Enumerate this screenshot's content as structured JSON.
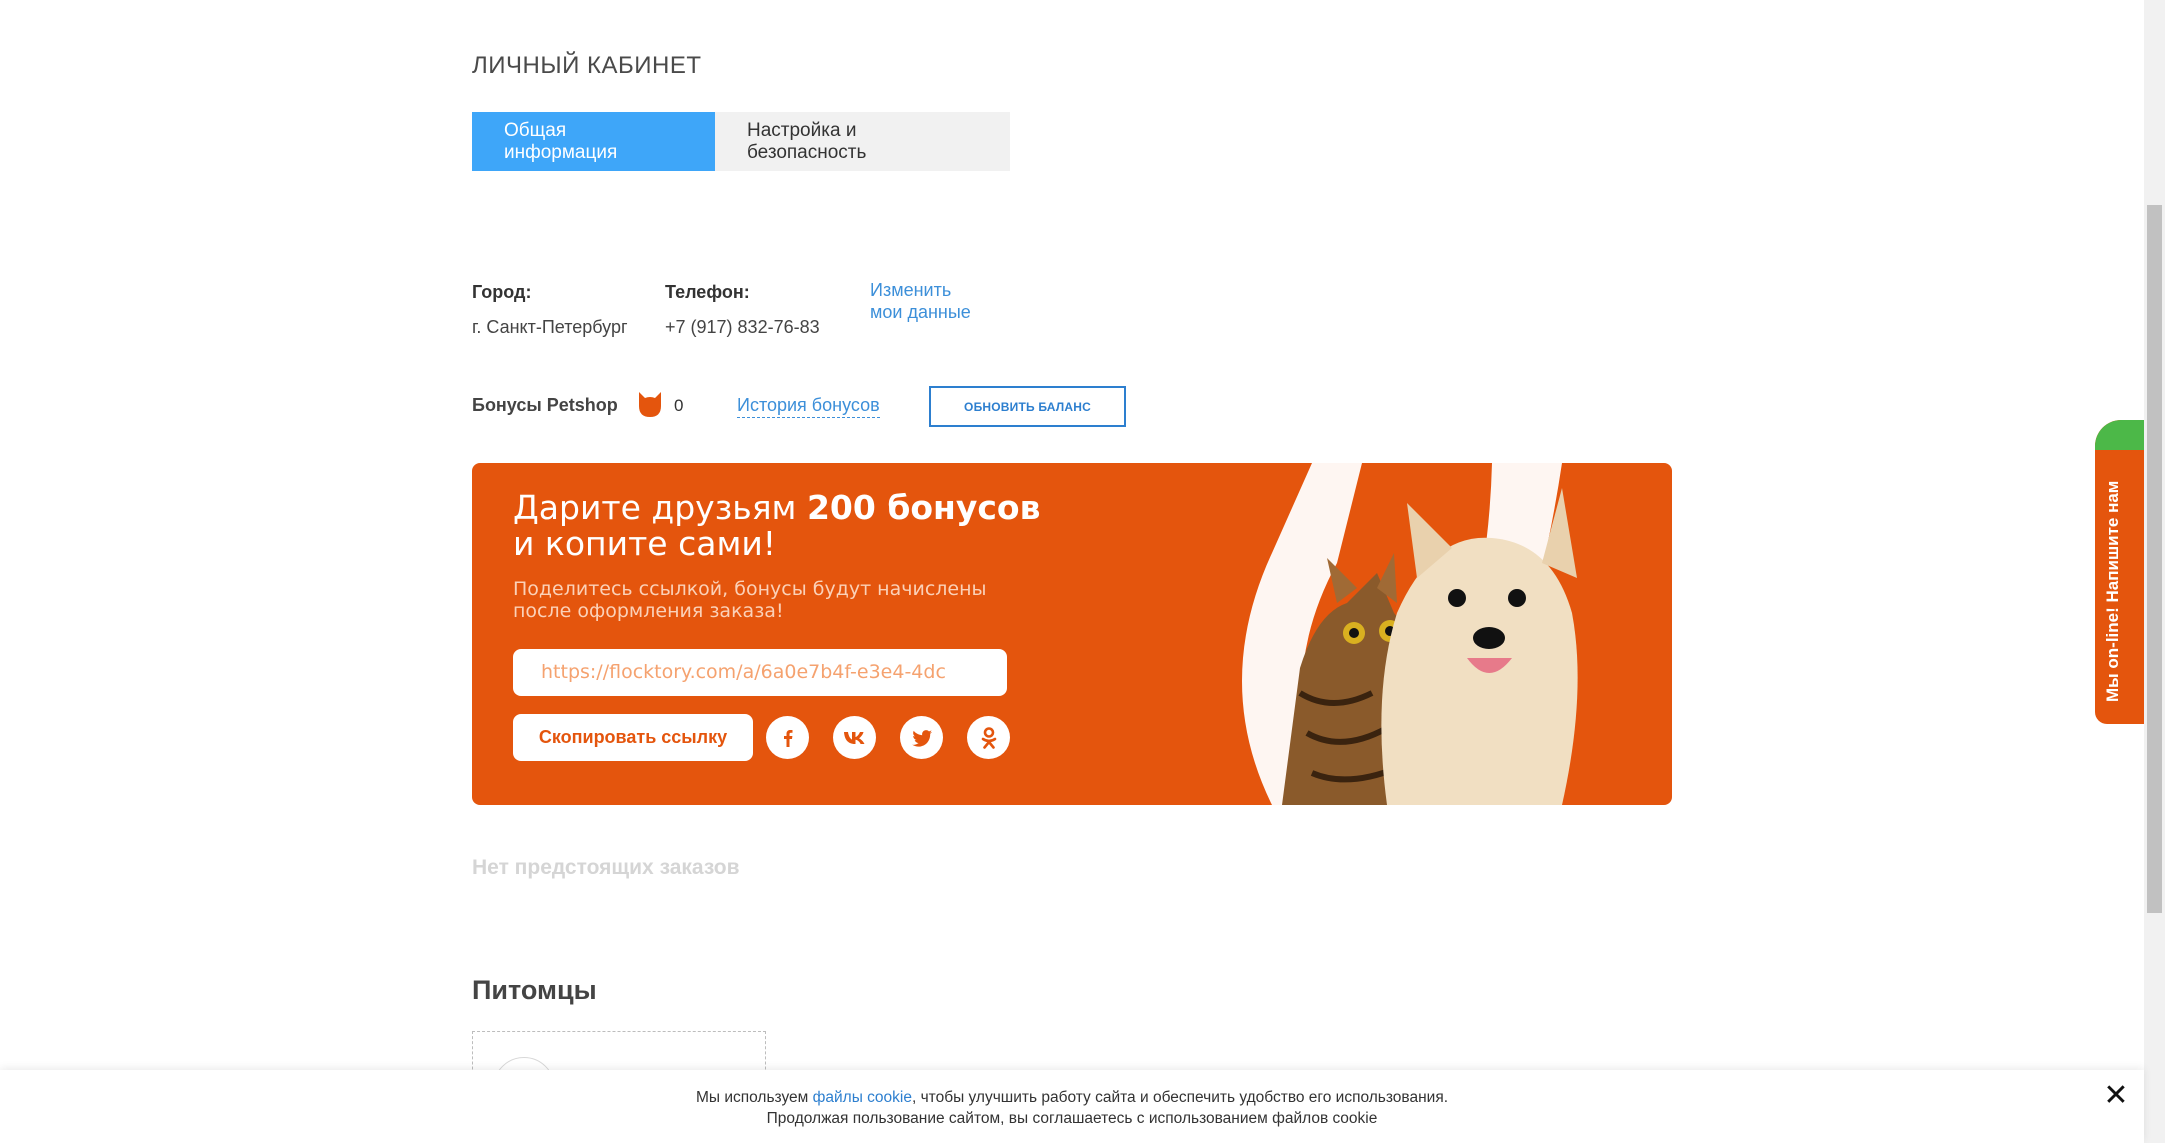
{
  "page": {
    "title": "ЛИЧНЫЙ КАБИНЕТ"
  },
  "tabs": [
    {
      "label": "Общая информация",
      "active": true
    },
    {
      "label": "Настройка и безопасность",
      "active": false
    }
  ],
  "profile": {
    "city_label": "Город:",
    "city_value": "г. Санкт-Петербург",
    "phone_label": "Телефон:",
    "phone_value": "+7 (917) 832-76-83",
    "edit_line1": "Изменить",
    "edit_line2": "мои данные"
  },
  "bonuses": {
    "label": "Бонусы Petshop",
    "count": "0",
    "history_link": "История бонусов",
    "refresh_button": "ОБНОВИТЬ БАЛАНС",
    "icon": "cat-icon"
  },
  "promo": {
    "title_part1": "Дарите друзьям ",
    "title_bold": "200 бонусов",
    "title_line2": "и копите сами!",
    "subtitle_line1": "Поделитесь ссылкой, бонусы будут начислены",
    "subtitle_line2": "после оформления заказа!",
    "link": "https://flocktory.com/a/6a0e7b4f-e3e4-4dc",
    "copy_button": "Скопировать ссылку",
    "socials": [
      "facebook-icon",
      "vk-icon",
      "twitter-icon",
      "odnoklassniki-icon"
    ],
    "brand_color": "#e4550d"
  },
  "orders": {
    "empty_text": "Нет предстоящих заказов"
  },
  "pets": {
    "title": "Питомцы"
  },
  "chat": {
    "label": "Мы on-line! Напишите нам"
  },
  "cookie": {
    "text_before": "Мы используем ",
    "link": "файлы cookie",
    "text_after": ", чтобы улучшить работу сайта и обеспечить удобство его использования.",
    "line2": "Продолжая пользование сайтом, вы соглашаетесь с использованием файлов cookie",
    "close_icon": "close-icon"
  },
  "colors": {
    "accent_blue": "#3ea6f9",
    "link_blue": "#3c8fd9",
    "orange": "#e4550d",
    "green": "#4cb848"
  }
}
